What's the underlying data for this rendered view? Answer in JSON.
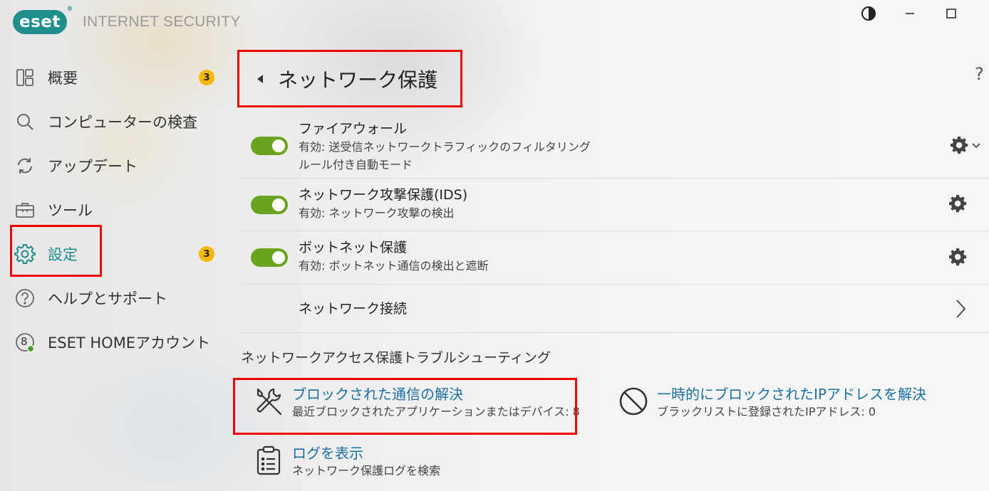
{
  "app": {
    "logo_text": "eset",
    "logo_mark": "®",
    "product_name": "INTERNET SECURITY"
  },
  "window_controls": {
    "theme_icon": "half-circle-icon",
    "minimize_icon": "minimize-icon",
    "maximize_icon": "maximize-icon"
  },
  "sidebar": {
    "items": [
      {
        "label": "概要",
        "icon": "dashboard-icon",
        "badge": "3"
      },
      {
        "label": "コンピューターの検査",
        "icon": "search-icon",
        "badge": ""
      },
      {
        "label": "アップデート",
        "icon": "refresh-icon",
        "badge": ""
      },
      {
        "label": "ツール",
        "icon": "toolbox-icon",
        "badge": ""
      },
      {
        "label": "設定",
        "icon": "gear-icon",
        "badge": "3"
      },
      {
        "label": "ヘルプとサポート",
        "icon": "question-icon",
        "badge": ""
      },
      {
        "label": "ESET HOMEアカウント",
        "icon": "account-icon",
        "badge": "",
        "avatar_number": "8"
      }
    ]
  },
  "header": {
    "title": "ネットワーク保護",
    "help_label": "?"
  },
  "rows": [
    {
      "title": "ファイアウォール",
      "status": "有効: 送受信ネットワークトラフィックのフィルタリング",
      "mode": "ルール付き自動モード"
    },
    {
      "title": "ネットワーク攻撃保護(IDS)",
      "status": "有効: ネットワーク攻撃の検出"
    },
    {
      "title": "ボットネット保護",
      "status": "有効: ボットネット通信の検出と遮断"
    },
    {
      "title": "ネットワーク接続"
    }
  ],
  "troubleshooting": {
    "section_title": "ネットワークアクセス保護トラブルシューティング",
    "actions": [
      {
        "title": "ブロックされた通信の解決",
        "subtitle": "最近ブロックされたアプリケーションまたはデバイス: 8",
        "icon": "tools-icon"
      },
      {
        "title": "一時的にブロックされたIPアドレスを解決",
        "subtitle": "ブラックリストに登録されたIPアドレス: 0",
        "icon": "block-icon"
      },
      {
        "title": "ログを表示",
        "subtitle": "ネットワーク保護ログを検索",
        "icon": "clipboard-icon"
      }
    ]
  },
  "colors": {
    "accent": "#1f8f8c",
    "toggle_on": "#6aa41e",
    "link": "#1a6fa3",
    "badge": "#f6b800",
    "highlight": "#e00000"
  }
}
